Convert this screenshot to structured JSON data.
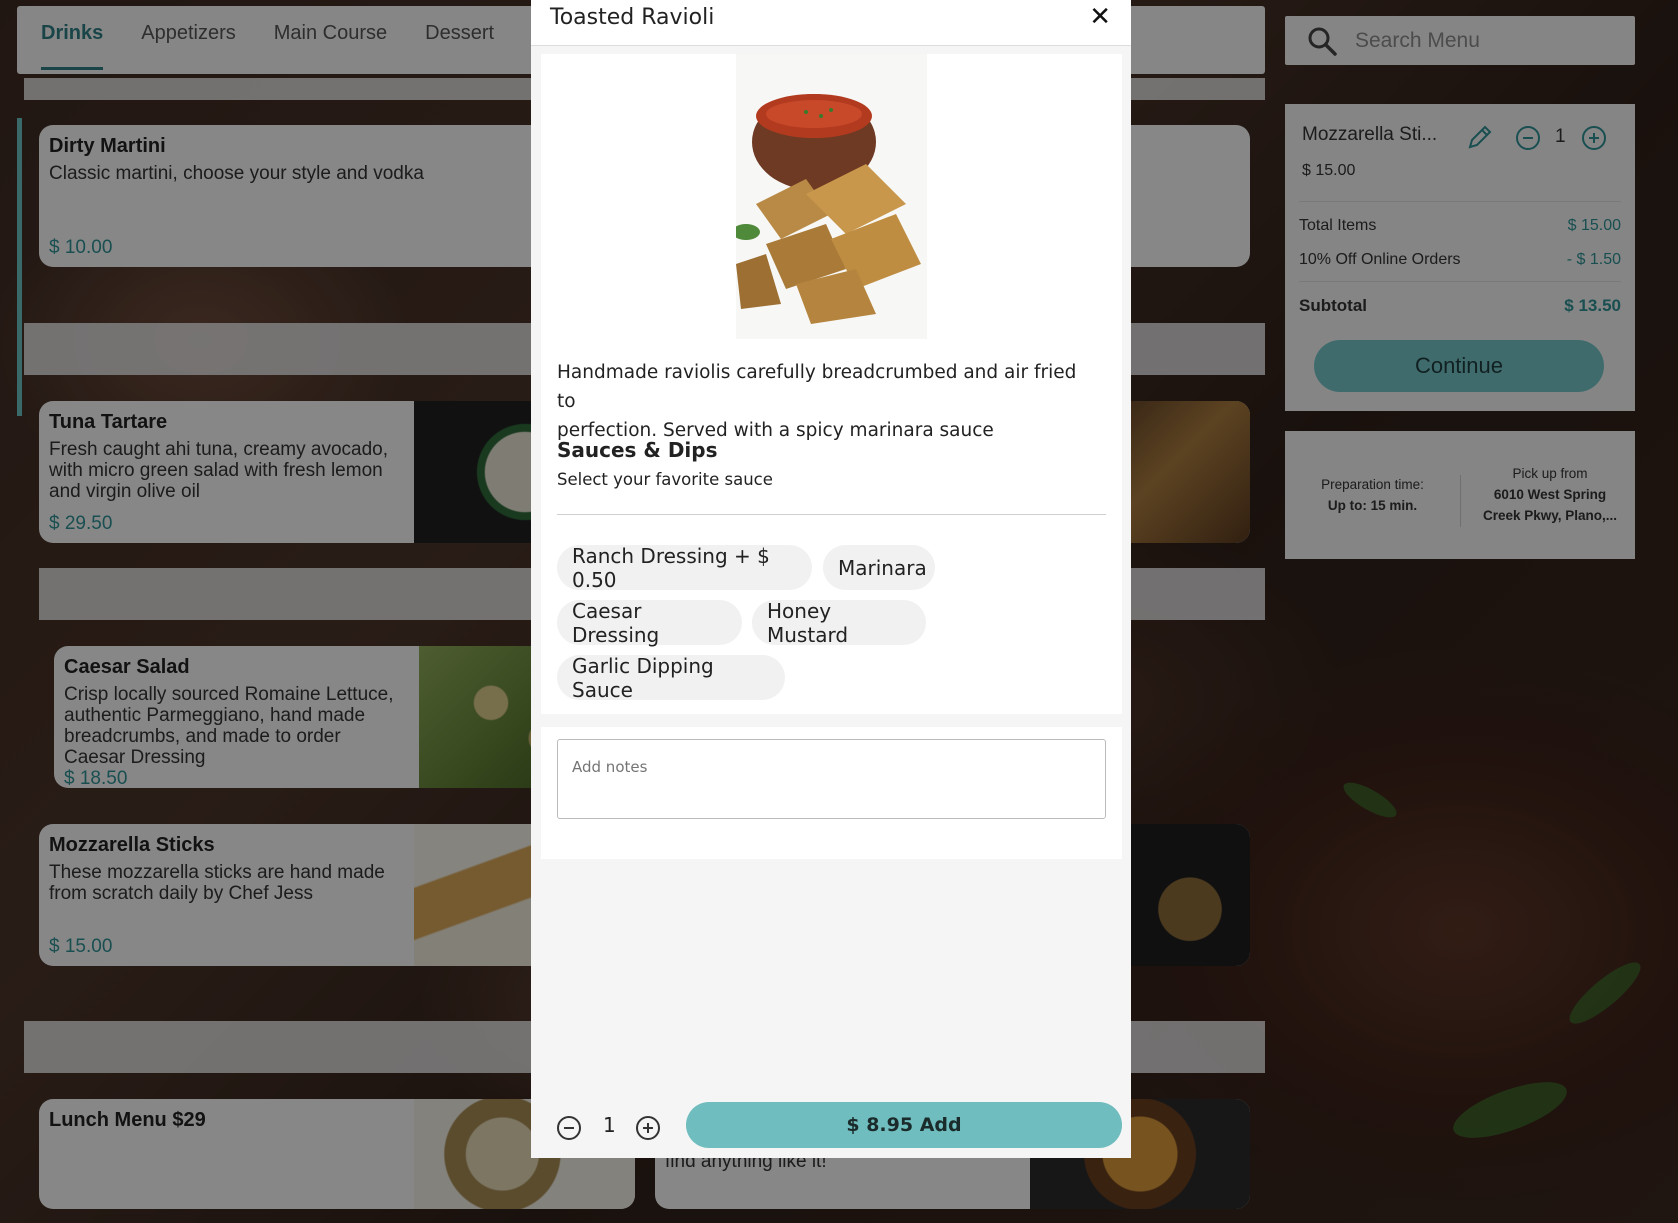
{
  "categories": {
    "tabs": [
      {
        "label": "Drinks",
        "active": true
      },
      {
        "label": "Appetizers",
        "active": false
      },
      {
        "label": "Main Course",
        "active": false
      },
      {
        "label": "Dessert",
        "active": false
      }
    ]
  },
  "menu_cards": [
    {
      "title": "Dirty Martini",
      "description": "Classic martini, choose your style and vodka",
      "price": "$ 10.00"
    },
    {
      "title": "Tuna Tartare",
      "description": "Fresh caught ahi tuna, creamy avocado, with micro green salad with fresh lemon and virgin olive oil",
      "price": "$ 29.50"
    },
    {
      "title": "Caesar Salad",
      "description": "Crisp locally sourced Romaine Lettuce, authentic Parmeggiano, hand made breadcrumbs, and made to order Caesar Dressing",
      "price": "$ 18.50"
    },
    {
      "title": "Mozzarella Sticks",
      "description": "These mozzarella sticks are hand made from scratch daily by Chef Jess",
      "price": "$ 15.00"
    },
    {
      "title": "Lunch Menu $29",
      "description": "",
      "price": ""
    },
    {
      "title": "",
      "description": "find anything like it!",
      "price": ""
    }
  ],
  "search": {
    "placeholder": "Search Menu"
  },
  "cart": {
    "item_name": "Mozzarella Sti...",
    "item_price": "$ 15.00",
    "item_qty": "1",
    "total_items_label": "Total Items",
    "total_items_value": "$ 15.00",
    "discount_label": "10% Off Online Orders",
    "discount_value": "- $ 1.50",
    "subtotal_label": "Subtotal",
    "subtotal_value": "$ 13.50",
    "continue_label": "Continue"
  },
  "pickup": {
    "prep_label": "Preparation time:",
    "prep_value": "Up to: 15 min.",
    "pickup_label": "Pick up from",
    "address_line1": "6010 West Spring",
    "address_line2": "Creek Pkwy, Plano,..."
  },
  "modal": {
    "title": "Toasted Ravioli",
    "close_icon": "close-icon",
    "description_line1": "Handmade raviolis carefully breadcrumbed and air fried to",
    "description_line2": "perfection. Served with a spicy marinara sauce",
    "options_title": "Sauces & Dips",
    "options_subtitle": "Select your favorite sauce",
    "options": [
      "Ranch Dressing + $ 0.50",
      "Marinara",
      "Caesar Dressing",
      "Honey Mustard",
      "Garlic Dipping Sauce"
    ],
    "notes_placeholder": "Add notes",
    "quantity": "1",
    "add_button_label": "$ 8.95 Add"
  },
  "colors": {
    "accent": "#6fbdbe",
    "price_text": "#2f9094",
    "active_tab": "#2f7f84"
  }
}
